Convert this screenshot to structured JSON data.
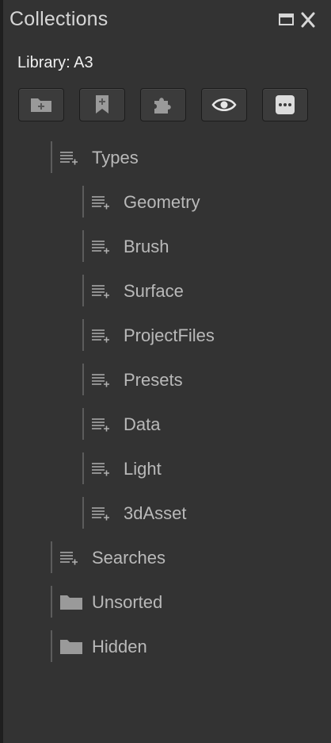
{
  "panel": {
    "title": "Collections",
    "maximize_icon": "maximize-window-icon",
    "close_icon": "close-icon"
  },
  "library": {
    "label": "Library: A3"
  },
  "toolbar": {
    "buttons": [
      {
        "icon": "new-folder-icon"
      },
      {
        "icon": "bookmark-add-icon"
      },
      {
        "icon": "puzzle-piece-icon"
      },
      {
        "icon": "eye-icon"
      },
      {
        "icon": "more-options-icon"
      }
    ]
  },
  "tree": {
    "items": [
      {
        "label": "Types",
        "icon": "smart-list-icon"
      },
      {
        "label": "Geometry",
        "icon": "smart-list-icon"
      },
      {
        "label": "Brush",
        "icon": "smart-list-icon"
      },
      {
        "label": "Surface",
        "icon": "smart-list-icon"
      },
      {
        "label": "ProjectFiles",
        "icon": "smart-list-icon"
      },
      {
        "label": "Presets",
        "icon": "smart-list-icon"
      },
      {
        "label": "Data",
        "icon": "smart-list-icon"
      },
      {
        "label": "Light",
        "icon": "smart-list-icon"
      },
      {
        "label": "3dAsset",
        "icon": "smart-list-icon"
      },
      {
        "label": "Searches",
        "icon": "smart-list-icon"
      },
      {
        "label": "Unsorted",
        "icon": "folder-icon"
      },
      {
        "label": "Hidden",
        "icon": "folder-icon"
      }
    ]
  },
  "colors": {
    "background": "#333333",
    "text": "#b9b9b9",
    "title": "#d6d6d6"
  }
}
